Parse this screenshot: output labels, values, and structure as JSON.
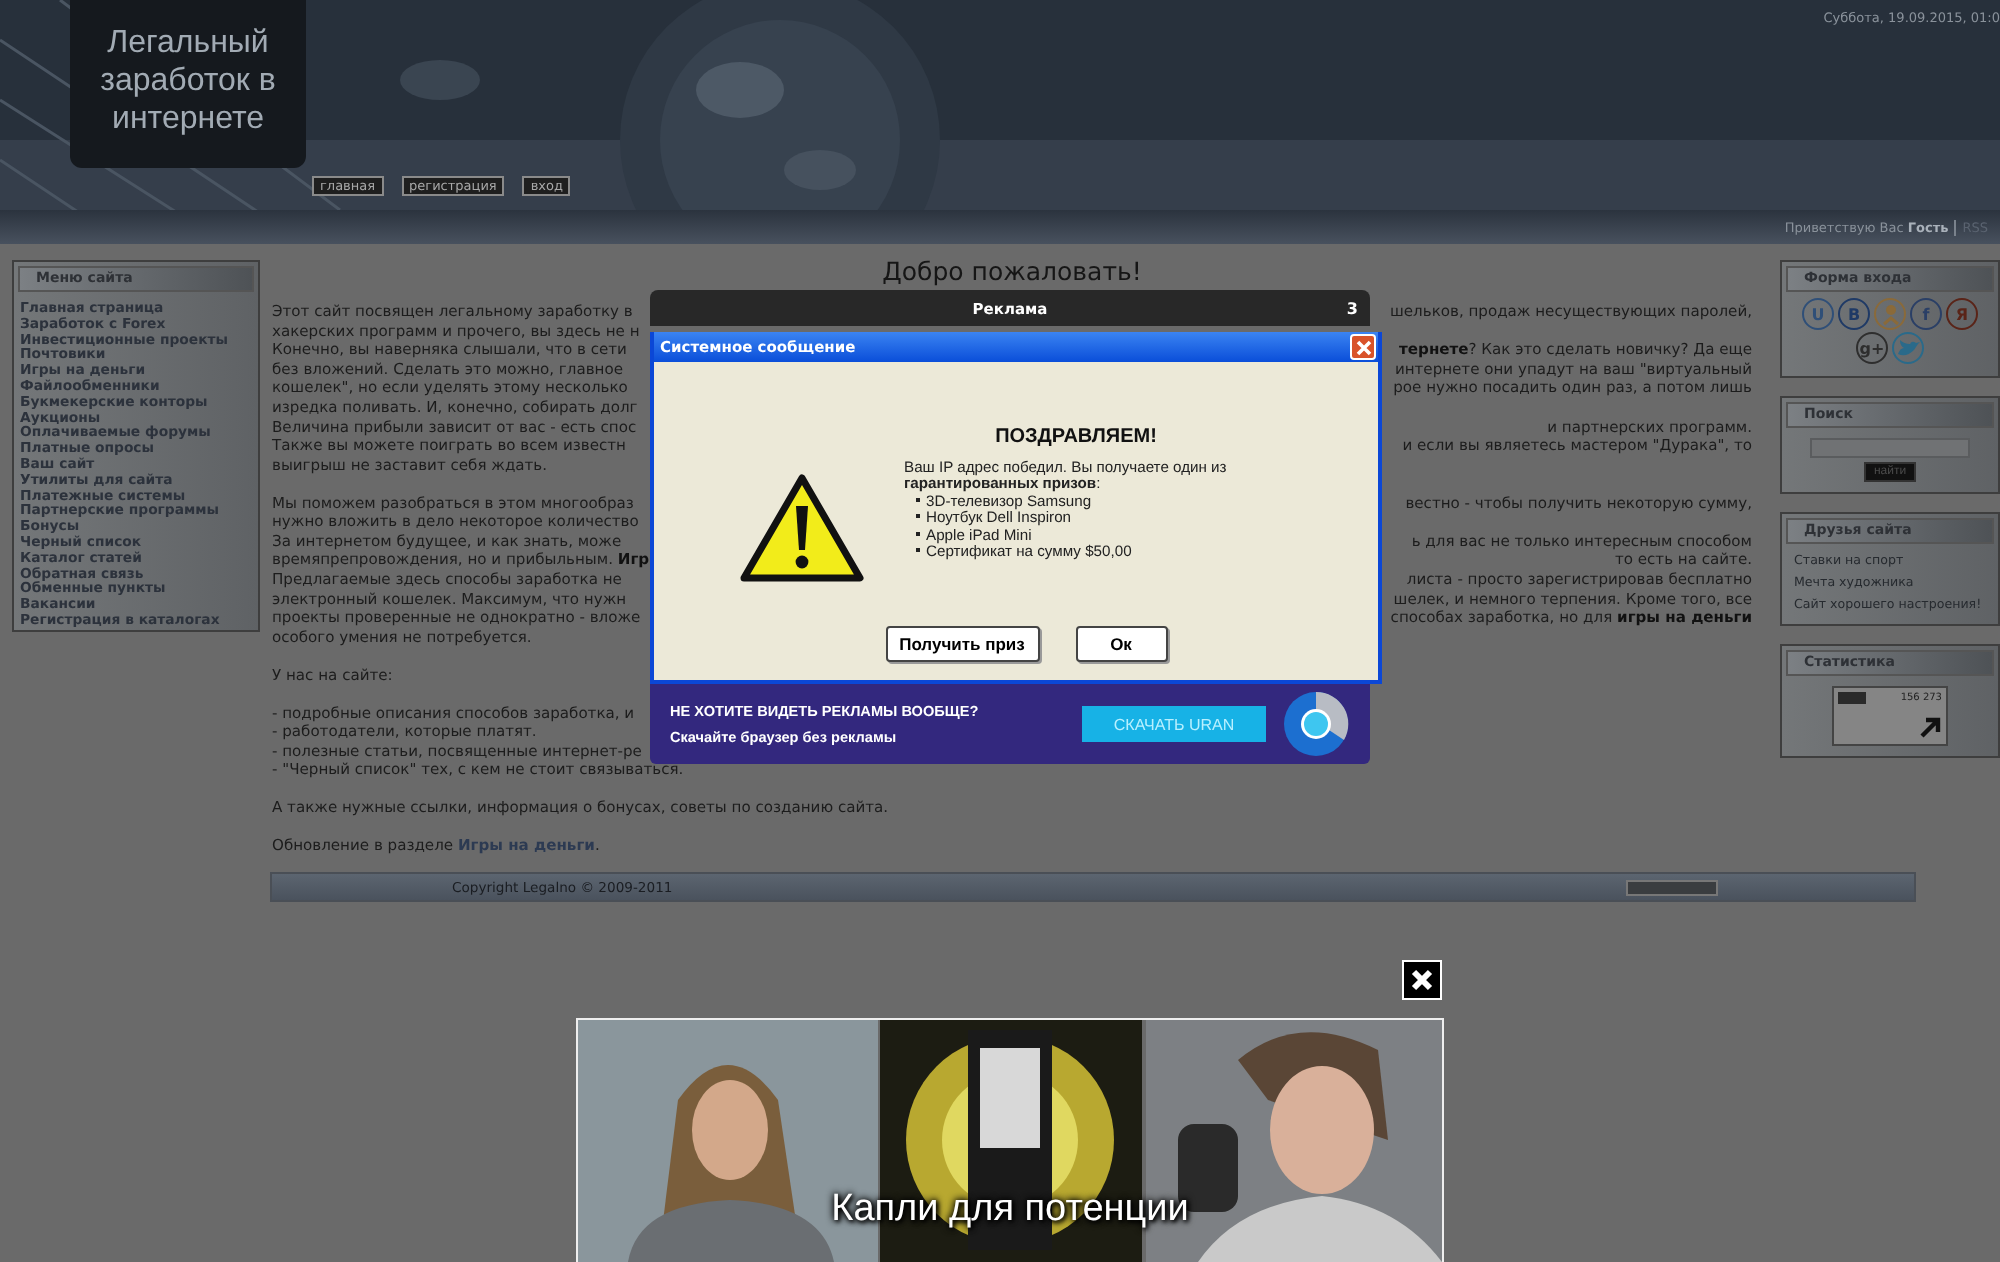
{
  "header": {
    "logo": "Легальный заработок в интернете",
    "date": "Суббота, 19.09.2015, 01:0",
    "nav": [
      {
        "label": "главная"
      },
      {
        "label": "регистрация"
      },
      {
        "label": "вход"
      }
    ],
    "greeting": "Приветствую Вас **Гость**",
    "rss": "RSS"
  },
  "menu": {
    "title": "Меню сайта",
    "items": [
      "Главная страница",
      "Заработок с Forex",
      "Инвестиционные проекты",
      "Почтовики",
      "Игры на деньги",
      "Файлообменники",
      "Букмекерские конторы",
      "Аукционы",
      "Оплачиваемые форумы",
      "Платные опросы",
      "Ваш сайт",
      "Утилиты для сайта",
      "Платежные системы",
      "Партнерские программы",
      "Бонусы",
      "Черный список",
      "Каталог статей",
      "Обратная связь",
      "Обменные пункты",
      "Вакансии",
      "Регистрация в каталогах"
    ]
  },
  "main": {
    "heading": "Добро пожаловать!",
    "paragraphs": [
      {
        "lines": [
          {
            "left": "Этот сайт посвящен легальному заработку в",
            "right": "шельков, продаж несуществующих паролей,"
          },
          {
            "left": "хакерских программ и прочего, вы здесь не н"
          },
          {
            "left": "Конечно, вы наверняка слышали, что в сети",
            "right": "**тернете**? Как это сделать новичку? Да еще"
          },
          {
            "left": "без вложений. Сделать это можно, главное",
            "right": "интернете они упадут на ваш \"виртуальный"
          },
          {
            "left": "кошелек\", но если уделять этому несколько",
            "right": "рое нужно посадить один раз, а потом лишь"
          },
          {
            "left": "изредка поливать. И, конечно, собирать долг"
          },
          {
            "left": "Величина прибыли зависит от вас - есть спос",
            "right": "и партнерских программ."
          },
          {
            "left": "Также вы можете поиграть во всем известн",
            "right": "и если вы являетесь мастером \"Дурака\", то"
          },
          {
            "left": "выигрыш не заставит себя ждать."
          }
        ]
      },
      {
        "lines": [
          {
            "left": "Мы поможем разобраться в этом многообраз",
            "right": "вестно - чтобы получить некоторую сумму,"
          },
          {
            "left": "нужно вложить в дело некоторое количество"
          },
          {
            "left": "За интернетом будущее, и как знать, може",
            "right": "ь для вас не только интересным  способом"
          },
          {
            "left": "времяпрепровождения, но и прибыльным. **Игр**",
            "right": "то есть на сайте."
          },
          {
            "left": "Предлагаемые здесь способы заработка не",
            "right": "листа - просто зарегистрировав бесплатно"
          },
          {
            "left": "электронный кошелек. Максимум, что нужн",
            "right": "шелек, и немного терпения. Кроме того, все"
          },
          {
            "left": "проекты проверенные не однократно - вложе",
            "right": "способах заработка, но для **игры на деньги**"
          },
          {
            "left": "особого умения не потребуется."
          }
        ]
      },
      {
        "lines": [
          {
            "left": "У нас на сайте:"
          }
        ]
      },
      {
        "lines": [
          {
            "left": "- подробные описания способов заработка, и"
          },
          {
            "left": "- работодатели, которые платят."
          },
          {
            "left": "- полезные статьи, посвященные интернет-ре"
          },
          {
            "left": "- \"Черный список\" тех, с кем не стоит связываться."
          }
        ]
      },
      {
        "lines": [
          {
            "left": "А также нужные ссылки, информация о бонусах, советы по созданию сайта."
          }
        ]
      }
    ],
    "update": {
      "text": "Обновление в разделе",
      "link": "Игры на деньги",
      "after": "."
    }
  },
  "sidebar": {
    "login": {
      "title": "Форма входа",
      "socials": [
        {
          "kind": "letter",
          "glyph": "U",
          "color": "#2f4f78"
        },
        {
          "kind": "letter",
          "glyph": "В",
          "color": "#1f3a66"
        },
        {
          "kind": "person",
          "color": "#8a6a3a"
        },
        {
          "kind": "letter",
          "glyph": "f",
          "color": "#2a3f66"
        },
        {
          "kind": "letter",
          "glyph": "Я",
          "color": "#5a2418"
        },
        {
          "kind": "letter",
          "glyph": "g+",
          "color": "#2e2e2e"
        },
        {
          "kind": "bird",
          "color": "#2a6a8a"
        }
      ]
    },
    "search": {
      "title": "Поиск",
      "button": "найти"
    },
    "friends": {
      "title": "Друзья сайта",
      "links": [
        "Ставки на спорт",
        "Мечта художника",
        "Сайт хорошего настроения!"
      ]
    },
    "stats": {
      "title": "Статистика",
      "counter": "156 273"
    }
  },
  "footer": {
    "copyright": "Copyright Legalno © 2009-2011"
  },
  "ad_dialog": {
    "header": "Реклама",
    "countdown": "3",
    "window": {
      "title": "Системное сообщение",
      "heading": "ПОЗДРАВЛЯЕМ!",
      "message": "Ваш IP адрес победил. Вы получаете один из **гарантированных призов**:",
      "prizes": [
        "3D-телевизор Samsung",
        "Ноутбук Dell Inspiron",
        "Apple iPad Mini",
        "Сертификат на сумму $50,00"
      ],
      "buttons": [
        "Получить приз",
        "Ок"
      ]
    },
    "banner": {
      "title": "НЕ ХОТИТЕ ВИДЕТЬ РЕКЛАМЫ ВООБЩЕ?",
      "subtitle": "Скачайте браузер без рекламы",
      "button": "СКАЧАТЬ URAN"
    }
  },
  "bottom_ad": {
    "kind": "picture",
    "caption": "Капли для потенции"
  }
}
